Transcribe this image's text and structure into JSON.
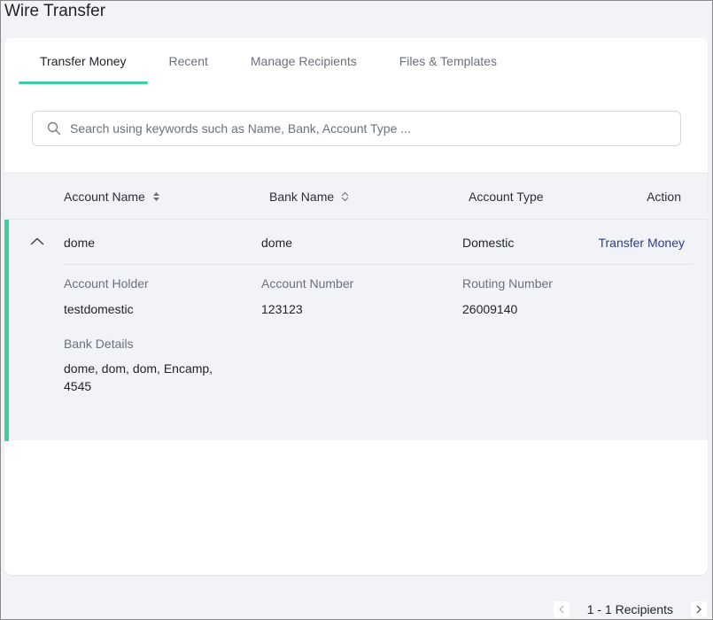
{
  "page": {
    "title": "Wire Transfer"
  },
  "tabs": [
    {
      "label": "Transfer Money",
      "active": true
    },
    {
      "label": "Recent",
      "active": false
    },
    {
      "label": "Manage Recipients",
      "active": false
    },
    {
      "label": "Files & Templates",
      "active": false
    }
  ],
  "search": {
    "placeholder": "Search using keywords such as Name, Bank, Account Type ...",
    "icon": "search-icon"
  },
  "table": {
    "columns": [
      "Account Name",
      "Bank Name",
      "Account Type",
      "Action"
    ],
    "rows": [
      {
        "account_name": "dome",
        "bank_name": "dome",
        "account_type": "Domestic",
        "action": "Transfer Money",
        "expanded": true,
        "details": {
          "account_holder_label": "Account Holder",
          "account_holder": "testdomestic",
          "account_number_label": "Account Number",
          "account_number": "123123",
          "routing_number_label": "Routing Number",
          "routing_number": "26009140",
          "bank_details_label": "Bank Details",
          "bank_details_line1": "dome, dom, dom, Encamp,",
          "bank_details_line2": "4545"
        }
      }
    ]
  },
  "pagination": {
    "summary": "1 - 1 Recipients"
  },
  "colors": {
    "accent": "#3ecf9f",
    "link": "#2f3f7a",
    "background": "#f1f3f6"
  }
}
